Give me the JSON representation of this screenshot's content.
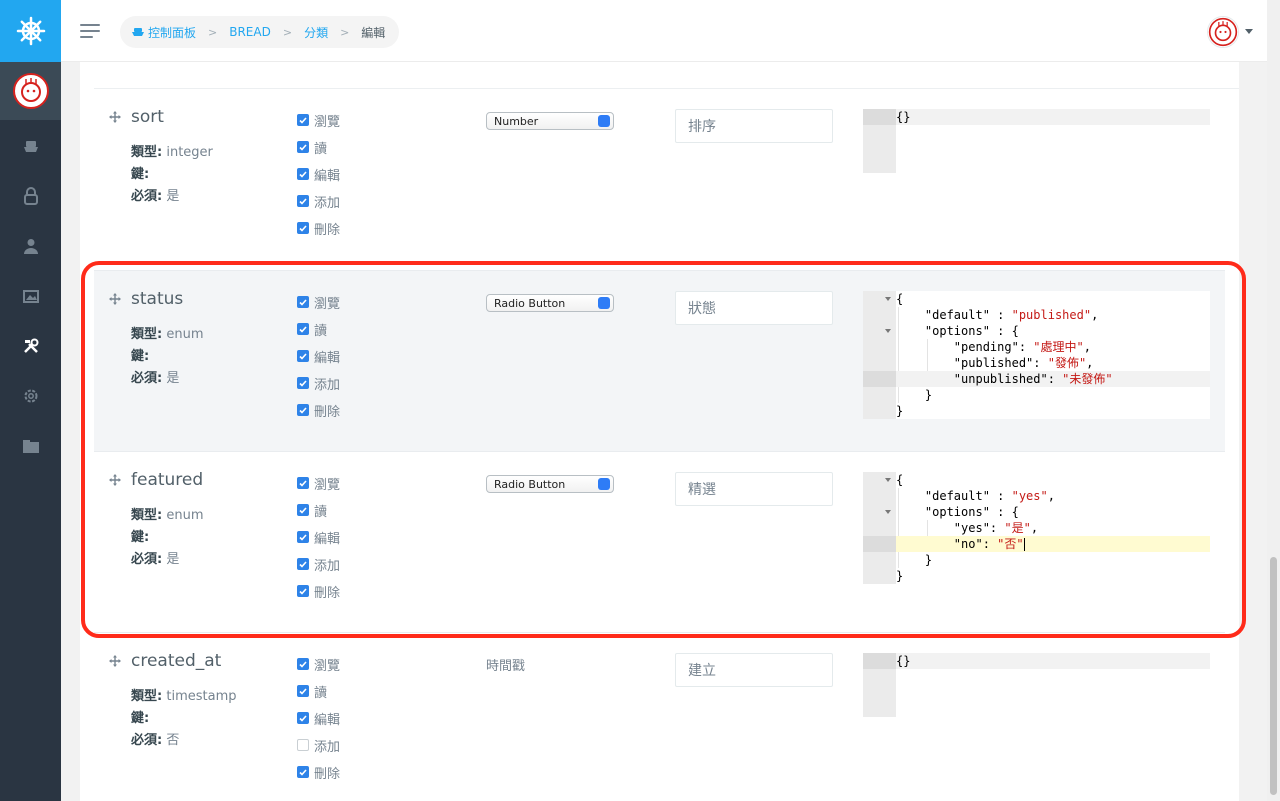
{
  "breadcrumb": {
    "home": "控制面板",
    "items": [
      "BREAD",
      "分類"
    ],
    "current": "編輯"
  },
  "labels": {
    "type": "類型",
    "key": "鍵",
    "required": "必須"
  },
  "permissions": [
    "瀏覽",
    "讀",
    "編輯",
    "添加",
    "刪除"
  ],
  "rows": [
    {
      "name": "sort",
      "type": "integer",
      "key": "",
      "required": "是",
      "perms": [
        true,
        true,
        true,
        true,
        true
      ],
      "input_type": "Number",
      "display_name": "排序",
      "details": [
        "{}"
      ]
    },
    {
      "name": "status",
      "type": "enum",
      "key": "",
      "required": "是",
      "perms": [
        true,
        true,
        true,
        true,
        true
      ],
      "input_type": "Radio Button",
      "display_name": "狀態",
      "details": [
        "{",
        "    \"default\" : \"published\",",
        "    \"options\" : {",
        "        \"pending\": \"處理中\",",
        "        \"published\": \"發佈\",",
        "        \"unpublished\": \"未發佈\"",
        "    }",
        "}"
      ]
    },
    {
      "name": "featured",
      "type": "enum",
      "key": "",
      "required": "是",
      "perms": [
        true,
        true,
        true,
        true,
        true
      ],
      "input_type": "Radio Button",
      "display_name": "精選",
      "details": [
        "{",
        "    \"default\" : \"yes\",",
        "    \"options\" : {",
        "        \"yes\": \"是\",",
        "        \"no\": \"否\"",
        "    }",
        "}"
      ]
    },
    {
      "name": "created_at",
      "type": "timestamp",
      "key": "",
      "required": "否",
      "perms": [
        true,
        true,
        true,
        false,
        true
      ],
      "input_type": "時間戳",
      "display_name": "建立",
      "details": [
        "{}"
      ]
    }
  ],
  "colors": {
    "accent": "#22a7f0",
    "sidebar": "#2a3542",
    "highlight_frame": "#ff2b1a",
    "checkbox": "#2e83e8",
    "json_string": "#c41a16"
  }
}
